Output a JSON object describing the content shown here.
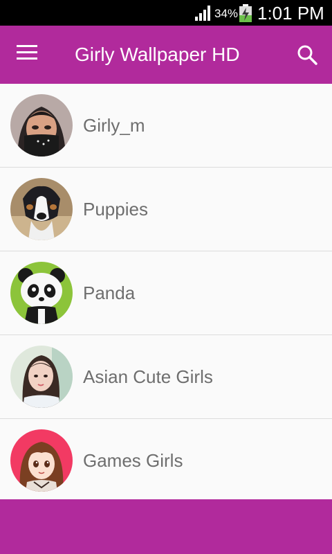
{
  "status_bar": {
    "battery_percent": "34%",
    "time": "1:01 PM",
    "icons": [
      "signal-icon",
      "battery-charging-icon"
    ]
  },
  "app_bar": {
    "title": "Girly Wallpaper HD",
    "icons": [
      "menu-icon",
      "search-icon"
    ]
  },
  "categories": [
    {
      "label": "Girly_m",
      "image": "girl-with-mask"
    },
    {
      "label": "Puppies",
      "image": "puppy"
    },
    {
      "label": "Panda",
      "image": "cartoon-panda"
    },
    {
      "label": "Asian Cute Girls",
      "image": "asian-girl"
    },
    {
      "label": "Games Girls",
      "image": "anime-girl"
    }
  ],
  "colors": {
    "primary": "#b12a9c",
    "list_background": "#fafafa",
    "label_text": "#6e6e6e",
    "divider": "#dcdcdc"
  }
}
